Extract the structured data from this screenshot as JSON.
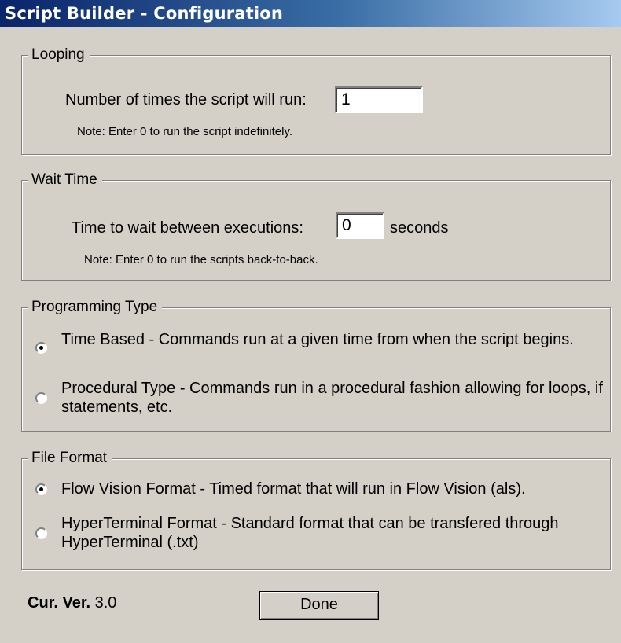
{
  "window": {
    "title": "Script Builder - Configuration"
  },
  "looping": {
    "legend": "Looping",
    "label": "Number of times the script will run:",
    "value": "1",
    "note": "Note:  Enter 0 to run the script indefinitely."
  },
  "wait_time": {
    "legend": "Wait Time",
    "label": "Time to wait between executions:",
    "value": "0",
    "unit": "seconds",
    "note": "Note:  Enter 0 to run the scripts back-to-back."
  },
  "programming_type": {
    "legend": "Programming Type",
    "options": [
      {
        "label": "Time Based - Commands run at a given time from when the script begins.",
        "selected": true
      },
      {
        "label": "Procedural Type - Commands run in a procedural fashion allowing for loops, if statements, etc.",
        "selected": false
      }
    ]
  },
  "file_format": {
    "legend": "File Format",
    "options": [
      {
        "label": "Flow Vision Format - Timed format that will run in Flow Vision (als).",
        "selected": true
      },
      {
        "label": "HyperTerminal Format - Standard format that can be transfered through HyperTerminal (.txt)",
        "selected": false
      }
    ]
  },
  "footer": {
    "version_label": "Cur. Ver.",
    "version_value": "3.0",
    "done_label": "Done"
  }
}
